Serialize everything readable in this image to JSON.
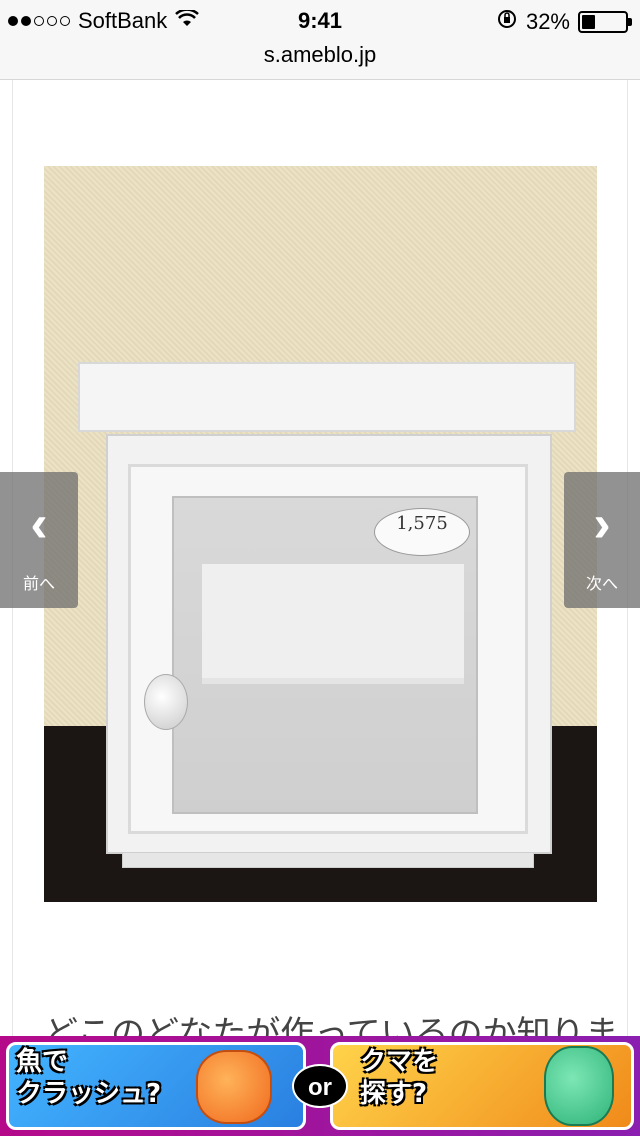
{
  "status_bar": {
    "carrier": "SoftBank",
    "signal_dots_filled": 2,
    "signal_dots_total": 5,
    "time": "9:41",
    "battery_percent": "32%",
    "battery_level": 0.32
  },
  "url_bar": {
    "url": "s.ameblo.jp"
  },
  "photo": {
    "price_tag": "1,575"
  },
  "nav": {
    "prev_label": "前へ",
    "next_label": "次へ",
    "prev_chevron": "‹",
    "next_chevron": "›"
  },
  "post": {
    "text": "どこのどなたが作っているのか知りま"
  },
  "ad": {
    "left_caption_1": "魚で",
    "left_caption_2": "クラッシュ?",
    "or_label": "or",
    "right_caption_1": "クマを",
    "right_caption_2": "探す?"
  }
}
